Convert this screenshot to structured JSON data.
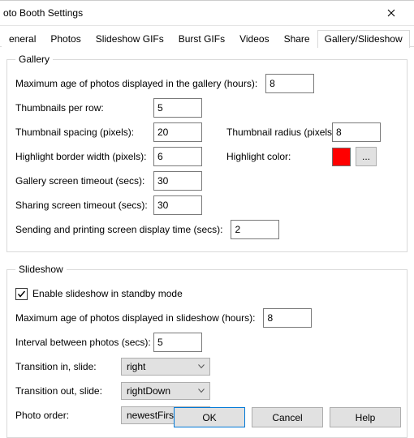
{
  "window": {
    "title": "oto Booth Settings"
  },
  "tabs": [
    {
      "label": "eneral"
    },
    {
      "label": "Photos"
    },
    {
      "label": "Slideshow GIFs"
    },
    {
      "label": "Burst GIFs"
    },
    {
      "label": "Videos"
    },
    {
      "label": "Share"
    },
    {
      "label": "Gallery/Slideshow"
    }
  ],
  "gallery": {
    "legend": "Gallery",
    "max_age_label": "Maximum age of photos displayed in the gallery (hours):",
    "max_age": "8",
    "thumbs_per_row_label": "Thumbnails per row:",
    "thumbs_per_row": "5",
    "thumb_spacing_label": "Thumbnail spacing (pixels):",
    "thumb_spacing": "20",
    "thumb_radius_label": "Thumbnail radius (pixels):",
    "thumb_radius": "8",
    "highlight_border_label": "Highlight border width (pixels):",
    "highlight_border": "6",
    "highlight_color_label": "Highlight color:",
    "highlight_color": "#ff0000",
    "color_btn": "...",
    "gallery_timeout_label": "Gallery screen timeout (secs):",
    "gallery_timeout": "30",
    "sharing_timeout_label": "Sharing screen timeout (secs):",
    "sharing_timeout": "30",
    "send_print_label": "Sending and printing screen display time (secs):",
    "send_print": "2"
  },
  "slideshow": {
    "legend": "Slideshow",
    "enable_label": "Enable slideshow in standby mode",
    "enabled": true,
    "max_age_label": "Maximum age of photos displayed in slideshow (hours):",
    "max_age": "8",
    "interval_label": "Interval between photos (secs):",
    "interval": "5",
    "transition_in_label": "Transition in, slide:",
    "transition_in": "right",
    "transition_out_label": "Transition out, slide:",
    "transition_out": "rightDown",
    "photo_order_label": "Photo order:",
    "photo_order": "newestFirst"
  },
  "buttons": {
    "ok": "OK",
    "cancel": "Cancel",
    "help": "Help"
  }
}
